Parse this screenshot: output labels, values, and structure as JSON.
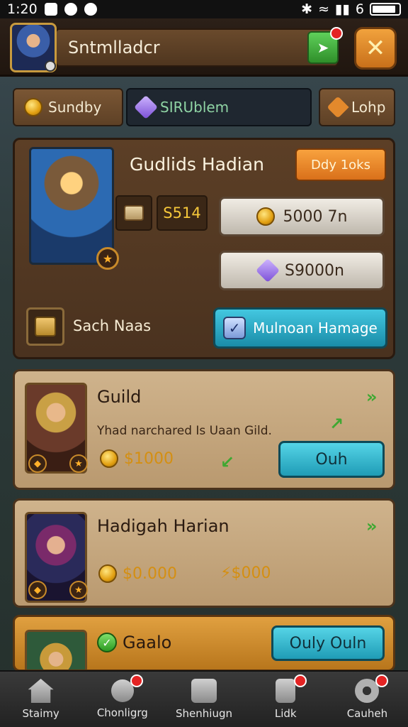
{
  "status_bar": {
    "time": "1:20",
    "signal_text": "6"
  },
  "header": {
    "player_name": "Sntmlladcr"
  },
  "tabs": [
    {
      "label": "Sundby"
    },
    {
      "label": "SIRUblem"
    },
    {
      "label": "Lohp"
    }
  ],
  "panel": {
    "title": "Gudlids Hadian",
    "buy_label": "Ddy 1oks",
    "item_price": "S514",
    "cost_gold": "5000 7n",
    "cost_gem": "S9000n",
    "note_label": "Sach Naas",
    "manage_label": "Mulnoan Hamage"
  },
  "cards": [
    {
      "title": "Guild",
      "subtitle": "Yhad narchared Is Uaan Gild.",
      "price": "$1000",
      "button": "Ouh"
    },
    {
      "title": "Hadigah Harian",
      "price_1": "$0.000",
      "price_2": "⚡$000"
    },
    {
      "title": "Gaalo",
      "button": "Ouly  Ouln"
    }
  ],
  "bottom_nav": [
    {
      "label": "Staimy",
      "icon": "home-icon"
    },
    {
      "label": "Chonligrg",
      "icon": "search-icon"
    },
    {
      "label": "Shenhiugn",
      "icon": "mail-icon"
    },
    {
      "label": "Lidk",
      "icon": "book-icon"
    },
    {
      "label": "Cauheh",
      "icon": "gear-icon"
    }
  ],
  "colors": {
    "accent_orange": "#f1a23d",
    "teal_button": "#43c7e0",
    "panel_brown": "#5c3f26",
    "card_tan": "#cfb38c"
  }
}
